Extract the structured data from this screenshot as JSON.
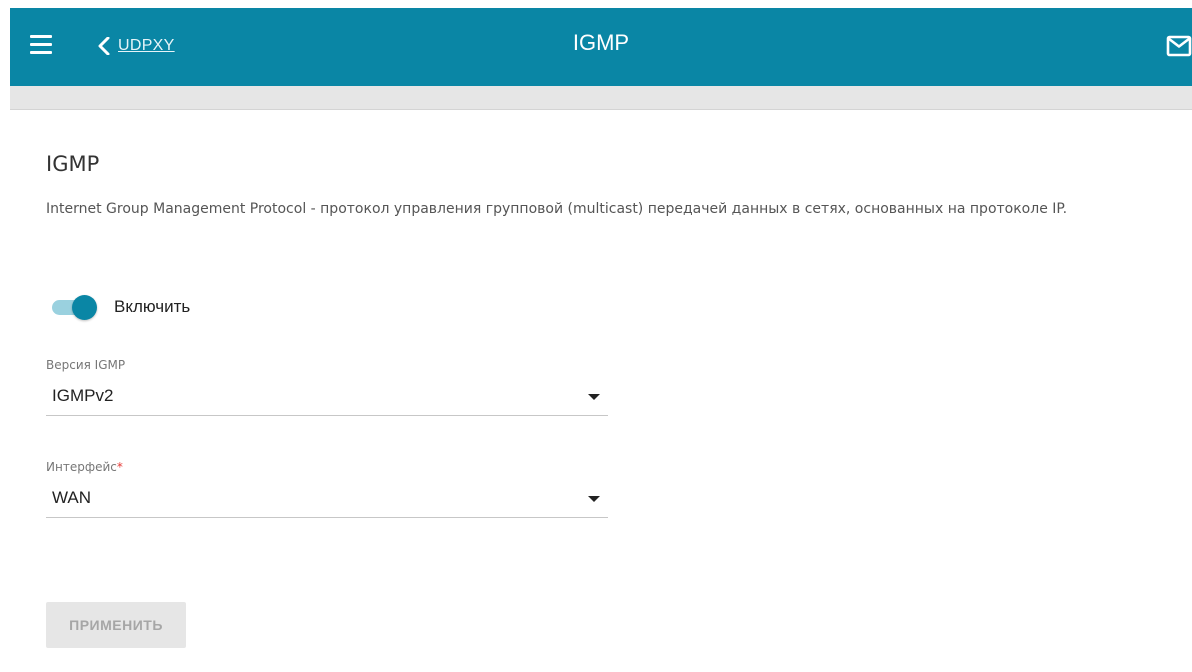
{
  "header": {
    "back_label": "UDPXY",
    "title": "IGMP",
    "accent_color": "#0a86a5"
  },
  "icons": {
    "menu": "hamburger-icon",
    "back": "chevron-left-icon",
    "mail": "envelope-icon",
    "dropdown": "caret-down-icon"
  },
  "section": {
    "title": "IGMP",
    "description": "Internet Group Management Protocol - протокол управления групповой (multicast) передачей данных в сетях, основанных на протоколе IP."
  },
  "enable_toggle": {
    "label": "Включить",
    "state": "on"
  },
  "igmp_version": {
    "label": "Версия IGMP",
    "value": "IGMPv2"
  },
  "interface": {
    "label": "Интерфейс",
    "required_mark": "*",
    "value": "WAN"
  },
  "actions": {
    "apply_label": "ПРИМЕНИТЬ",
    "apply_enabled": false
  }
}
